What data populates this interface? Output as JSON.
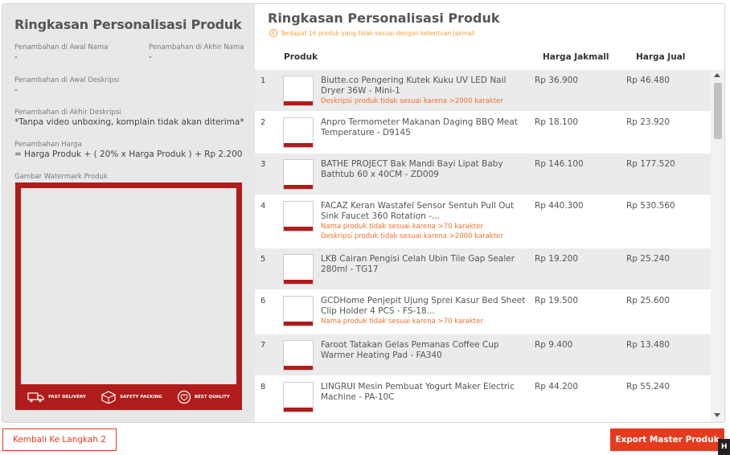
{
  "left_panel": {
    "title": "Ringkasan Personalisasi Produk",
    "prefix_name_label": "Penambahan di Awal Nama",
    "prefix_name_value": "-",
    "suffix_name_label": "Penambahan di Akhir Nama",
    "suffix_name_value": "-",
    "prefix_desc_label": "Penambahan di Awal Deskripsi",
    "prefix_desc_value": "-",
    "suffix_desc_label": "Penambahan di Akhir Deskripsi",
    "suffix_desc_value": "*Tanpa video unboxing, komplain tidak akan diterima*",
    "price_label": "Penambahan Harga",
    "price_value": "= Harga Produk + ( 20% x Harga Produk ) + Rp 2.200",
    "watermark_label": "Gambar Watermark Produk",
    "watermark_badges": [
      "FAST DELIVERY",
      "SAFETY PACKING",
      "BEST QUALITY"
    ],
    "watermark_color": "#b01c1c"
  },
  "right_panel": {
    "title": "Ringkasan Personalisasi Produk",
    "warning": "Terdapat 16 produk yang tidak sesuai dengan ketentuan Jakmall",
    "columns": [
      "Produk",
      "Harga Jakmall",
      "Harga Jual"
    ],
    "rows": [
      {
        "no": "1",
        "name": "Biutte.co Pengering Kutek Kuku UV LED Nail Dryer 36W - Mini-1",
        "errors": [
          "Deskripsi produk tidak sesuai karena >2000 karakter"
        ],
        "harga_jakmall": "Rp 36.900",
        "harga_jual": "Rp 46.480"
      },
      {
        "no": "2",
        "name": "Anpro Termometer Makanan Daging BBQ Meat Temperature - D9145",
        "errors": [],
        "harga_jakmall": "Rp 18.100",
        "harga_jual": "Rp 23.920"
      },
      {
        "no": "3",
        "name": "BATHE PROJECT Bak Mandi Bayi Lipat Baby Bathtub 60 x 40CM - ZD009",
        "errors": [],
        "harga_jakmall": "Rp 146.100",
        "harga_jual": "Rp 177.520"
      },
      {
        "no": "4",
        "name": "FACAZ Keran Wastafel Sensor Sentuh Pull Out Sink Faucet 360 Rotation -...",
        "errors": [
          "Nama produk tidak sesuai karena >70 karakter",
          "Deskripsi produk tidak sesuai karena >2000 karakter"
        ],
        "harga_jakmall": "Rp 440.300",
        "harga_jual": "Rp 530.560"
      },
      {
        "no": "5",
        "name": "LKB Cairan Pengisi Celah Ubin Tile Gap Sealer 280ml - TG17",
        "errors": [],
        "harga_jakmall": "Rp 19.200",
        "harga_jual": "Rp 25.240"
      },
      {
        "no": "6",
        "name": "GCDHome Penjepit Ujung Sprei Kasur Bed Sheet Clip Holder 4 PCS - FS-18...",
        "errors": [
          "Nama produk tidak sesuai karena >70 karakter"
        ],
        "harga_jakmall": "Rp 19.500",
        "harga_jual": "Rp 25.600"
      },
      {
        "no": "7",
        "name": "Faroot Tatakan Gelas Pemanas Coffee Cup Warmer Heating Pad - FA340",
        "errors": [],
        "harga_jakmall": "Rp 9.400",
        "harga_jual": "Rp 13.480"
      },
      {
        "no": "8",
        "name": "LINGRUI Mesin Pembuat Yogurt Maker Electric Machine - PA-10C",
        "errors": [],
        "harga_jakmall": "Rp 44.200",
        "harga_jual": "Rp 55.240"
      }
    ]
  },
  "footer": {
    "back_label": "Kembali Ke Langkah 2",
    "export_label": "Export Master Produk",
    "help_label": "H",
    "accent_color": "#e53a1e"
  }
}
